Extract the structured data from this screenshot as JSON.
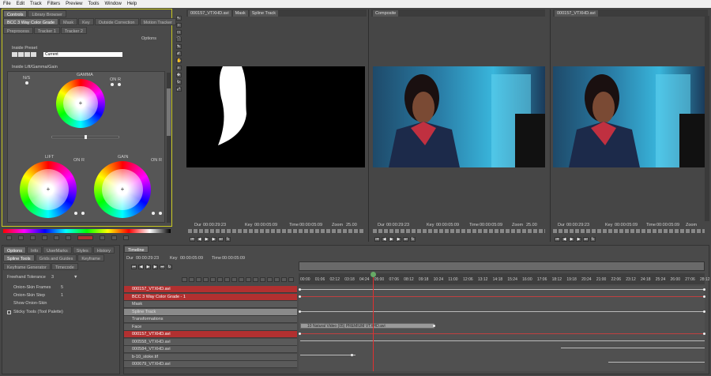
{
  "menu": [
    "File",
    "Edit",
    "Track",
    "Filters",
    "Preview",
    "Tools",
    "Window",
    "Help"
  ],
  "controls": {
    "tabs": [
      "Controls",
      "Library Browser"
    ],
    "sub_tabs_1": [
      "BCC 3 Way Color Grade",
      "Mask",
      "Key",
      "Outside Correction",
      "Motion Tracker"
    ],
    "sub_tabs_2": [
      "Preprocess",
      "Tracker 1",
      "Tracker 2"
    ],
    "options_label": "Options",
    "inside_preset_label": "Inside Preset",
    "preset_value": "Current",
    "lift_gamma_gain_label": "Inside Lift/Gamma/Gain",
    "ns_label": "N/S",
    "gamma_label": "GAMMA",
    "lift_label": "LIFT",
    "gain_label": "GAIN",
    "on_label": "ON",
    "r_label": "R",
    "colors": {
      "accent": "#c8c820",
      "red": "#b23030"
    }
  },
  "viewers": [
    {
      "tabs": [
        "000157_VTXHD.avi",
        "Mask",
        "Spline Track"
      ],
      "dur": "00:00:29:23",
      "key": "00:00:05:09",
      "time": "00:00:05:09",
      "zoom": "25.00"
    },
    {
      "tabs": [
        "Composite"
      ],
      "dur": "00:00:29:23",
      "key": "00:00:05:09",
      "time": "00:00:05:09",
      "zoom": "25.00"
    },
    {
      "tabs": [
        "000157_VTXHD.avi"
      ],
      "dur": "00:00:29:23",
      "key": "00:00:05:09",
      "time": "00:00:05:09",
      "zoom": "25.00"
    }
  ],
  "readout_labels": {
    "dur": "Dur",
    "key": "Key",
    "time": "Time",
    "zoom": "Zoom"
  },
  "options_panel": {
    "tabs": [
      "Options",
      "Info",
      "UserMarks",
      "Styles",
      "History"
    ],
    "sub_tabs": [
      "Spline Tools",
      "Grids and Guides",
      "Keyframe"
    ],
    "sub_tabs_2": [
      "Keyframe Generator",
      "Timecode"
    ],
    "freehand_label": "Freehand Tolerance",
    "freehand_value": "3",
    "onion_frames_label": "Onion-Skin Frames",
    "onion_frames_value": "5",
    "onion_step_label": "Onion-Skin Step",
    "onion_step_value": "1",
    "show_onion_label": "Show Onion-Skin",
    "sticky_label": "Sticky Tools (Tool Palette)"
  },
  "timeline": {
    "tab": "Timeline",
    "dur_label": "Dur",
    "dur": "00:00:29:23",
    "key_label": "Key",
    "key": "00:00:05:09",
    "time_label": "Time",
    "time": "00:00:05:09",
    "ruler": [
      "00:00",
      "01:06",
      "02:12",
      "03:18",
      "04:24",
      "05:00",
      "07:06",
      "08:12",
      "09:18",
      "10:24",
      "11:00",
      "12:06",
      "13:12",
      "14:18",
      "15:24",
      "16:00",
      "17:06",
      "18:12",
      "19:18",
      "20:24",
      "21:00",
      "22:06",
      "23:12",
      "24:18",
      "25:24",
      "26:00",
      "27:06",
      "28:12"
    ],
    "rows": [
      {
        "label": "000157_VTXHD.avi",
        "style": "red"
      },
      {
        "label": "BCC 3 Way Color Grade - 1",
        "style": "red"
      },
      {
        "label": "Mask",
        "style": "normal"
      },
      {
        "label": "Spline Track",
        "style": "light"
      },
      {
        "label": "Transformations",
        "style": "normal"
      },
      {
        "label": "Face",
        "style": "normal"
      },
      {
        "label": "000157_VTXHD.avi",
        "style": "red"
      },
      {
        "label": "000558_VTXHD.avi",
        "style": "normal"
      },
      {
        "label": "000584_VTXHD.avi",
        "style": "normal"
      },
      {
        "label": "b-10_stoke.tif",
        "style": "normal"
      },
      {
        "label": "000679_VTXHD.avi",
        "style": "normal"
      }
    ],
    "clip_label": "10 Natural Video (05) PREMIUM VTXHD.avi"
  }
}
